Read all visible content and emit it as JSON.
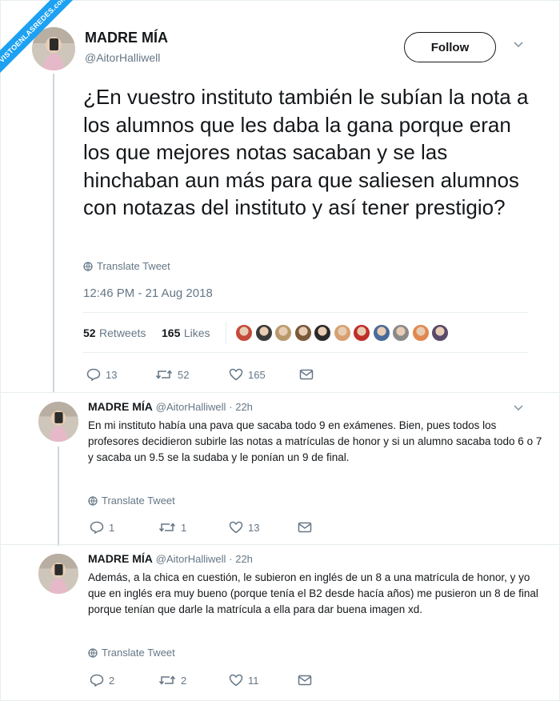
{
  "watermark": "VISTOENLASREDES.com",
  "main_tweet": {
    "name": "MADRE MÍA",
    "handle": "@AitorHalliwell",
    "follow_label": "Follow",
    "text": "¿En vuestro instituto también le subían la nota a los alumnos que les daba la gana porque eran los que mejores notas sacaban y se las hinchaban aun más para que saliesen alumnos con notazas del instituto y así tener prestigio?",
    "translate": "Translate Tweet",
    "timestamp": "12:46 PM - 21 Aug 2018",
    "retweets_count": "52",
    "retweets_label": "Retweets",
    "likes_count": "165",
    "likes_label": "Likes",
    "liker_colors": [
      "#c44a3a",
      "#3a3a3a",
      "#b89a6a",
      "#7a5a3a",
      "#2a2a2a",
      "#d8a070",
      "#c0302a",
      "#4a6a9a",
      "#8a8a8a",
      "#e08850",
      "#5a4a6a"
    ],
    "actions": {
      "replies": "13",
      "retweets": "52",
      "likes": "165"
    }
  },
  "replies": [
    {
      "name": "MADRE MÍA",
      "handle": "@AitorHalliwell",
      "time": "· 22h",
      "text": "En mi instituto había una pava que sacaba todo 9 en exámenes. Bien, pues todos los profesores decidieron subirle las notas a matrículas de honor y si un alumno sacaba todo 6 o 7 y sacaba un 9.5 se la sudaba y le ponían un 9 de final.",
      "translate": "Translate Tweet",
      "actions": {
        "replies": "1",
        "retweets": "1",
        "likes": "13"
      }
    },
    {
      "name": "MADRE MÍA",
      "handle": "@AitorHalliwell",
      "time": "· 22h",
      "text": "Además, a la chica en cuestión, le subieron en inglés de un 8 a una matrícula de honor, y yo que en inglés era muy bueno (porque tenía el B2 desde hacía años) me pusieron un 8 de final porque tenían que darle la matrícula a ella para dar buena imagen xd.",
      "translate": "Translate Tweet",
      "actions": {
        "replies": "2",
        "retweets": "2",
        "likes": "11"
      }
    }
  ]
}
